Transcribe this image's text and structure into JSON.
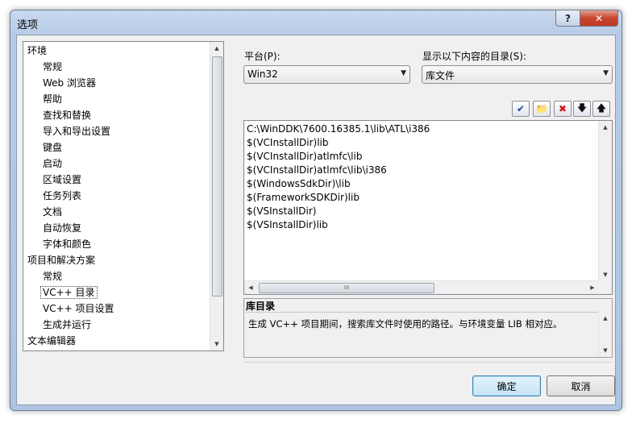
{
  "window": {
    "title": "选项",
    "help_glyph": "?",
    "close_glyph": "✕"
  },
  "tree": {
    "items": [
      {
        "label": "环境",
        "level": 0
      },
      {
        "label": "常规",
        "level": 1
      },
      {
        "label": "Web 浏览器",
        "level": 1
      },
      {
        "label": "帮助",
        "level": 1
      },
      {
        "label": "查找和替换",
        "level": 1
      },
      {
        "label": "导入和导出设置",
        "level": 1
      },
      {
        "label": "键盘",
        "level": 1
      },
      {
        "label": "启动",
        "level": 1
      },
      {
        "label": "区域设置",
        "level": 1
      },
      {
        "label": "任务列表",
        "level": 1
      },
      {
        "label": "文档",
        "level": 1
      },
      {
        "label": "自动恢复",
        "level": 1
      },
      {
        "label": "字体和颜色",
        "level": 1
      },
      {
        "label": "项目和解决方案",
        "level": 0
      },
      {
        "label": "常规",
        "level": 1
      },
      {
        "label": "VC++ 目录",
        "level": 1,
        "selected": true
      },
      {
        "label": "VC++ 项目设置",
        "level": 1
      },
      {
        "label": "生成并运行",
        "level": 1
      },
      {
        "label": "文本编辑器",
        "level": 0
      }
    ]
  },
  "platform": {
    "label": "平台(P):",
    "value": "Win32"
  },
  "show_dirs": {
    "label": "显示以下内容的目录(S):",
    "value": "库文件"
  },
  "toolbar": {
    "check_icon": "✔",
    "new_folder_icon": "📁",
    "delete_icon": "✖",
    "move_down_icon": "🡇",
    "move_up_icon": "🡅"
  },
  "directories": [
    "C:\\WinDDK\\7600.16385.1\\lib\\ATL\\i386",
    "$(VCInstallDir)lib",
    "$(VCInstallDir)atlmfc\\lib",
    "$(VCInstallDir)atlmfc\\lib\\i386",
    "$(WindowsSdkDir)\\lib",
    "$(FrameworkSDKDir)lib",
    "$(VSInstallDir)",
    "$(VSInstallDir)lib"
  ],
  "description": {
    "title": "库目录",
    "text": "生成 VC++ 项目期间，搜索库文件时使用的路径。与环境变量 LIB 相对应。"
  },
  "buttons": {
    "ok": "确定",
    "cancel": "取消"
  },
  "scroll": {
    "up": "▲",
    "down": "▼",
    "left": "◀",
    "right": "▶",
    "grip": "III"
  },
  "combo_arrow": "▼"
}
